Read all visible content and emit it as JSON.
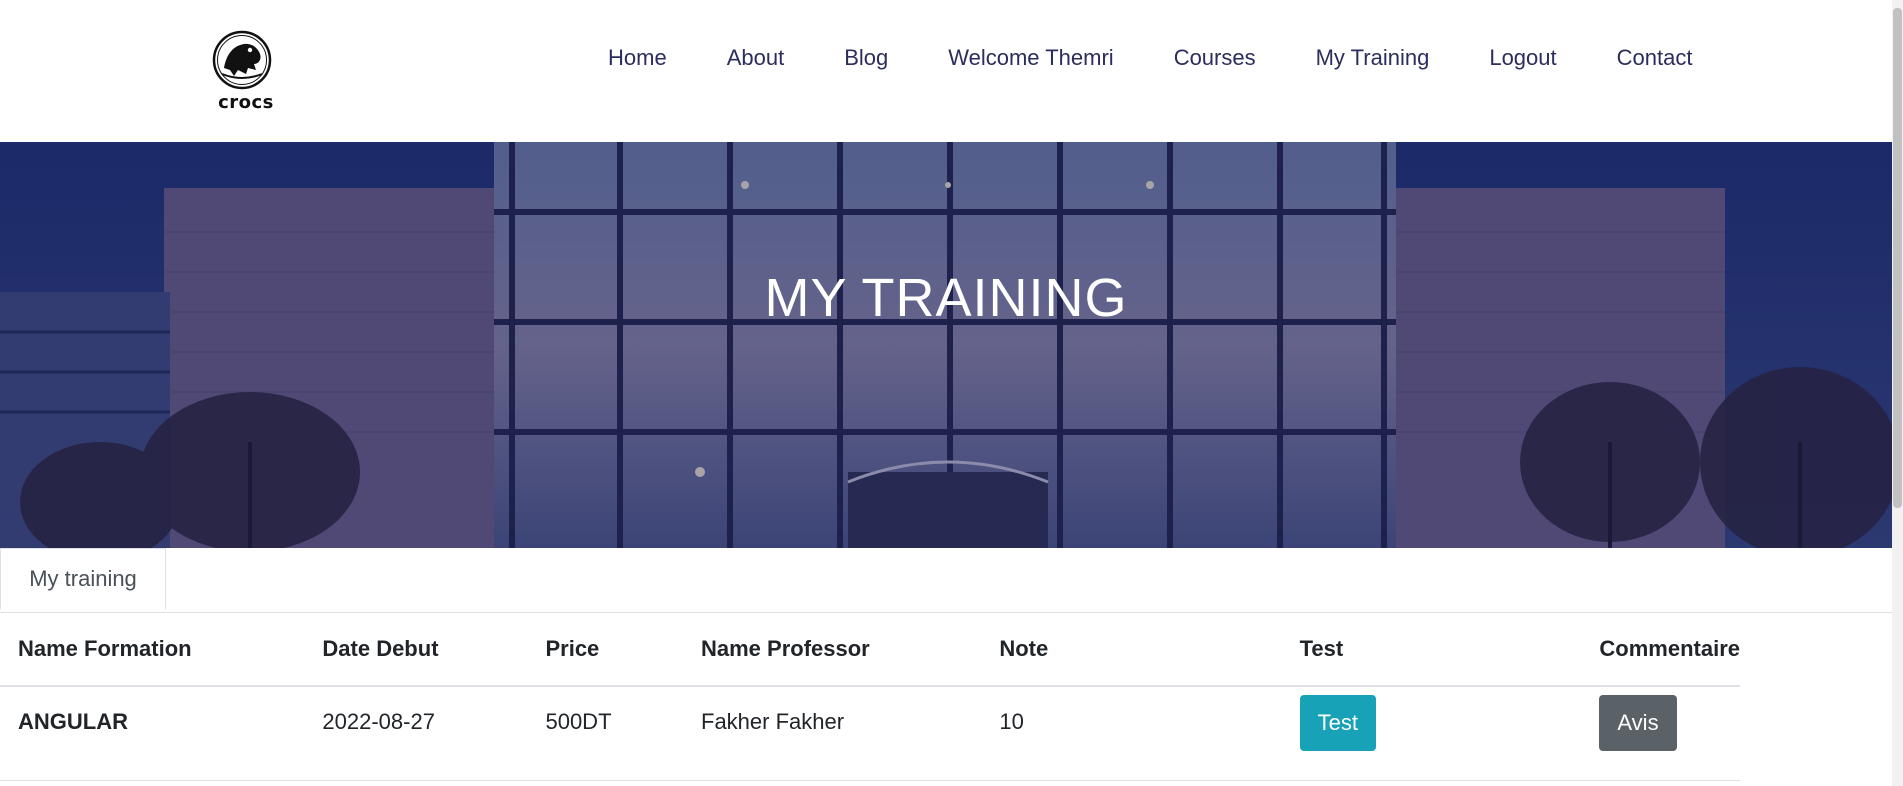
{
  "header": {
    "logo_text": "crocs",
    "nav": [
      {
        "label": "Home"
      },
      {
        "label": "About"
      },
      {
        "label": "Blog"
      },
      {
        "label": "Welcome Themri"
      },
      {
        "label": "Courses"
      },
      {
        "label": "My Training"
      },
      {
        "label": "Logout"
      },
      {
        "label": "Contact"
      }
    ]
  },
  "hero": {
    "title": "MY TRAINING"
  },
  "tabs": {
    "active_label": "My training"
  },
  "table": {
    "headers": [
      "Name Formation",
      "Date Debut",
      "Price",
      "Name Professor",
      "Note",
      "Test",
      "Commentaire"
    ],
    "rows": [
      {
        "name_formation": "ANGULAR",
        "date_debut": "2022-08-27",
        "price": "500DT",
        "name_professor": "Fakher Fakher",
        "note": "10",
        "test_button": "Test",
        "comment_button": "Avis"
      }
    ]
  },
  "colors": {
    "nav_text": "#2b2d5c",
    "test_button": "#17a2b8",
    "avis_button": "#5a6268"
  }
}
